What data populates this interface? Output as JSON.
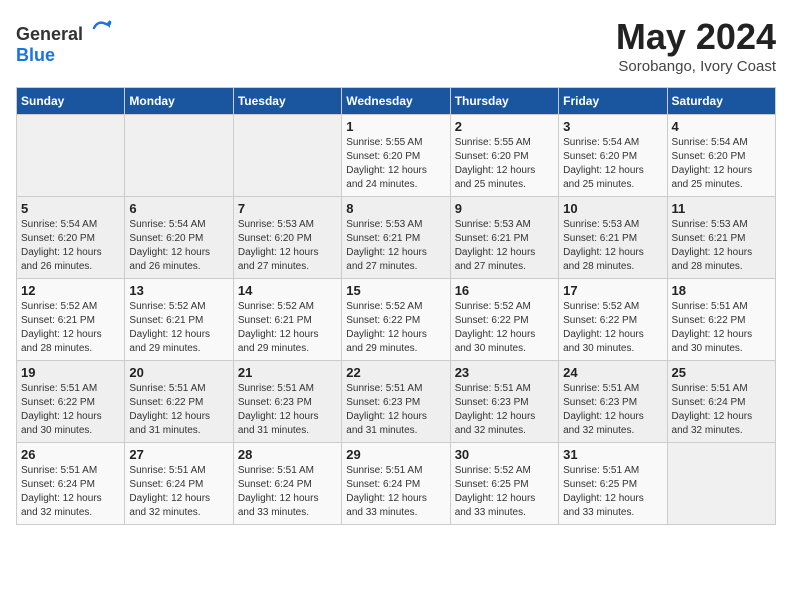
{
  "logo": {
    "text_general": "General",
    "text_blue": "Blue"
  },
  "title": "May 2024",
  "subtitle": "Sorobango, Ivory Coast",
  "days_of_week": [
    "Sunday",
    "Monday",
    "Tuesday",
    "Wednesday",
    "Thursday",
    "Friday",
    "Saturday"
  ],
  "weeks": [
    [
      {
        "day": "",
        "info": ""
      },
      {
        "day": "",
        "info": ""
      },
      {
        "day": "",
        "info": ""
      },
      {
        "day": "1",
        "sunrise": "5:55 AM",
        "sunset": "6:20 PM",
        "daylight": "12 hours and 24 minutes."
      },
      {
        "day": "2",
        "sunrise": "5:55 AM",
        "sunset": "6:20 PM",
        "daylight": "12 hours and 25 minutes."
      },
      {
        "day": "3",
        "sunrise": "5:54 AM",
        "sunset": "6:20 PM",
        "daylight": "12 hours and 25 minutes."
      },
      {
        "day": "4",
        "sunrise": "5:54 AM",
        "sunset": "6:20 PM",
        "daylight": "12 hours and 25 minutes."
      }
    ],
    [
      {
        "day": "5",
        "sunrise": "5:54 AM",
        "sunset": "6:20 PM",
        "daylight": "12 hours and 26 minutes."
      },
      {
        "day": "6",
        "sunrise": "5:54 AM",
        "sunset": "6:20 PM",
        "daylight": "12 hours and 26 minutes."
      },
      {
        "day": "7",
        "sunrise": "5:53 AM",
        "sunset": "6:20 PM",
        "daylight": "12 hours and 27 minutes."
      },
      {
        "day": "8",
        "sunrise": "5:53 AM",
        "sunset": "6:21 PM",
        "daylight": "12 hours and 27 minutes."
      },
      {
        "day": "9",
        "sunrise": "5:53 AM",
        "sunset": "6:21 PM",
        "daylight": "12 hours and 27 minutes."
      },
      {
        "day": "10",
        "sunrise": "5:53 AM",
        "sunset": "6:21 PM",
        "daylight": "12 hours and 28 minutes."
      },
      {
        "day": "11",
        "sunrise": "5:53 AM",
        "sunset": "6:21 PM",
        "daylight": "12 hours and 28 minutes."
      }
    ],
    [
      {
        "day": "12",
        "sunrise": "5:52 AM",
        "sunset": "6:21 PM",
        "daylight": "12 hours and 28 minutes."
      },
      {
        "day": "13",
        "sunrise": "5:52 AM",
        "sunset": "6:21 PM",
        "daylight": "12 hours and 29 minutes."
      },
      {
        "day": "14",
        "sunrise": "5:52 AM",
        "sunset": "6:21 PM",
        "daylight": "12 hours and 29 minutes."
      },
      {
        "day": "15",
        "sunrise": "5:52 AM",
        "sunset": "6:22 PM",
        "daylight": "12 hours and 29 minutes."
      },
      {
        "day": "16",
        "sunrise": "5:52 AM",
        "sunset": "6:22 PM",
        "daylight": "12 hours and 30 minutes."
      },
      {
        "day": "17",
        "sunrise": "5:52 AM",
        "sunset": "6:22 PM",
        "daylight": "12 hours and 30 minutes."
      },
      {
        "day": "18",
        "sunrise": "5:51 AM",
        "sunset": "6:22 PM",
        "daylight": "12 hours and 30 minutes."
      }
    ],
    [
      {
        "day": "19",
        "sunrise": "5:51 AM",
        "sunset": "6:22 PM",
        "daylight": "12 hours and 30 minutes."
      },
      {
        "day": "20",
        "sunrise": "5:51 AM",
        "sunset": "6:22 PM",
        "daylight": "12 hours and 31 minutes."
      },
      {
        "day": "21",
        "sunrise": "5:51 AM",
        "sunset": "6:23 PM",
        "daylight": "12 hours and 31 minutes."
      },
      {
        "day": "22",
        "sunrise": "5:51 AM",
        "sunset": "6:23 PM",
        "daylight": "12 hours and 31 minutes."
      },
      {
        "day": "23",
        "sunrise": "5:51 AM",
        "sunset": "6:23 PM",
        "daylight": "12 hours and 32 minutes."
      },
      {
        "day": "24",
        "sunrise": "5:51 AM",
        "sunset": "6:23 PM",
        "daylight": "12 hours and 32 minutes."
      },
      {
        "day": "25",
        "sunrise": "5:51 AM",
        "sunset": "6:24 PM",
        "daylight": "12 hours and 32 minutes."
      }
    ],
    [
      {
        "day": "26",
        "sunrise": "5:51 AM",
        "sunset": "6:24 PM",
        "daylight": "12 hours and 32 minutes."
      },
      {
        "day": "27",
        "sunrise": "5:51 AM",
        "sunset": "6:24 PM",
        "daylight": "12 hours and 32 minutes."
      },
      {
        "day": "28",
        "sunrise": "5:51 AM",
        "sunset": "6:24 PM",
        "daylight": "12 hours and 33 minutes."
      },
      {
        "day": "29",
        "sunrise": "5:51 AM",
        "sunset": "6:24 PM",
        "daylight": "12 hours and 33 minutes."
      },
      {
        "day": "30",
        "sunrise": "5:52 AM",
        "sunset": "6:25 PM",
        "daylight": "12 hours and 33 minutes."
      },
      {
        "day": "31",
        "sunrise": "5:51 AM",
        "sunset": "6:25 PM",
        "daylight": "12 hours and 33 minutes."
      },
      {
        "day": "",
        "info": ""
      }
    ]
  ]
}
